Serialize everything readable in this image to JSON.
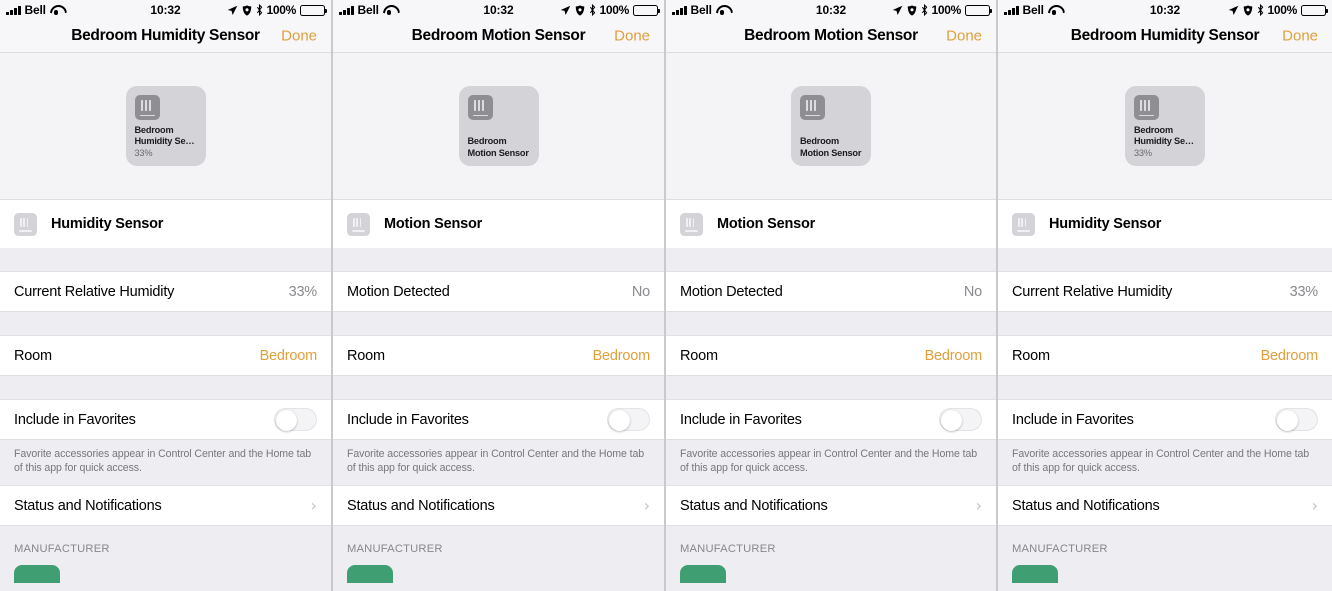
{
  "status_bar": {
    "carrier": "Bell",
    "time": "10:32",
    "battery_percent": "100%",
    "icons": [
      "signal-bars-icon",
      "wifi-icon",
      "location-arrow-icon",
      "alarm-clock-icon",
      "bluetooth-icon",
      "battery-icon"
    ]
  },
  "colors": {
    "accent": "#e0a03c",
    "group_background": "#eeeef2",
    "row_background": "#ffffff",
    "value_gray": "#8a8a8e",
    "tile_background": "#d3d3d8",
    "manufacturer_logo": "#3f9e72"
  },
  "panels": [
    {
      "nav": {
        "title": "Bedroom Humidity Sensor",
        "done_label": "Done"
      },
      "tile": {
        "name": "Bedroom\nHumidity Se…",
        "name_line1": "Bedroom",
        "name_line2": "Humidity Se…",
        "status": "33%",
        "icon": "sensor-icon"
      },
      "service": {
        "title": "Humidity Sensor",
        "icon": "sensor-icon"
      },
      "rows": [
        {
          "label": "Current Relative Humidity",
          "value": "33%",
          "accent": false
        },
        {
          "label": "Room",
          "value": "Bedroom",
          "accent": true
        }
      ],
      "favorites": {
        "label": "Include in Favorites",
        "enabled": false,
        "footnote": "Favorite accessories appear in Control Center and the Home tab of this app for quick access."
      },
      "status_notifications": {
        "label": "Status and Notifications"
      },
      "manufacturer_section": {
        "title": "MANUFACTURER"
      }
    },
    {
      "nav": {
        "title": "Bedroom Motion Sensor",
        "done_label": "Done"
      },
      "tile": {
        "name": "Bedroom\nMotion Sensor",
        "name_line1": "Bedroom",
        "name_line2": "Motion Sensor",
        "status": "",
        "icon": "sensor-icon"
      },
      "service": {
        "title": "Motion Sensor",
        "icon": "sensor-icon"
      },
      "rows": [
        {
          "label": "Motion Detected",
          "value": "No",
          "accent": false
        },
        {
          "label": "Room",
          "value": "Bedroom",
          "accent": true
        }
      ],
      "favorites": {
        "label": "Include in Favorites",
        "enabled": false,
        "footnote": "Favorite accessories appear in Control Center and the Home tab of this app for quick access."
      },
      "status_notifications": {
        "label": "Status and Notifications"
      },
      "manufacturer_section": {
        "title": "MANUFACTURER"
      }
    },
    {
      "nav": {
        "title": "Bedroom Motion Sensor",
        "done_label": "Done"
      },
      "tile": {
        "name": "Bedroom\nMotion Sensor",
        "name_line1": "Bedroom",
        "name_line2": "Motion Sensor",
        "status": "",
        "icon": "sensor-icon"
      },
      "service": {
        "title": "Motion Sensor",
        "icon": "sensor-icon"
      },
      "rows": [
        {
          "label": "Motion Detected",
          "value": "No",
          "accent": false
        },
        {
          "label": "Room",
          "value": "Bedroom",
          "accent": true
        }
      ],
      "favorites": {
        "label": "Include in Favorites",
        "enabled": false,
        "footnote": "Favorite accessories appear in Control Center and the Home tab of this app for quick access."
      },
      "status_notifications": {
        "label": "Status and Notifications"
      },
      "manufacturer_section": {
        "title": "MANUFACTURER"
      }
    },
    {
      "nav": {
        "title": "Bedroom Humidity Sensor",
        "done_label": "Done"
      },
      "tile": {
        "name": "Bedroom\nHumidity Se…",
        "name_line1": "Bedroom",
        "name_line2": "Humidity Se…",
        "status": "33%",
        "icon": "sensor-icon"
      },
      "service": {
        "title": "Humidity Sensor",
        "icon": "sensor-icon"
      },
      "rows": [
        {
          "label": "Current Relative Humidity",
          "value": "33%",
          "accent": false
        },
        {
          "label": "Room",
          "value": "Bedroom",
          "accent": true
        }
      ],
      "favorites": {
        "label": "Include in Favorites",
        "enabled": false,
        "footnote": "Favorite accessories appear in Control Center and the Home tab of this app for quick access."
      },
      "status_notifications": {
        "label": "Status and Notifications"
      },
      "manufacturer_section": {
        "title": "MANUFACTURER"
      }
    }
  ]
}
